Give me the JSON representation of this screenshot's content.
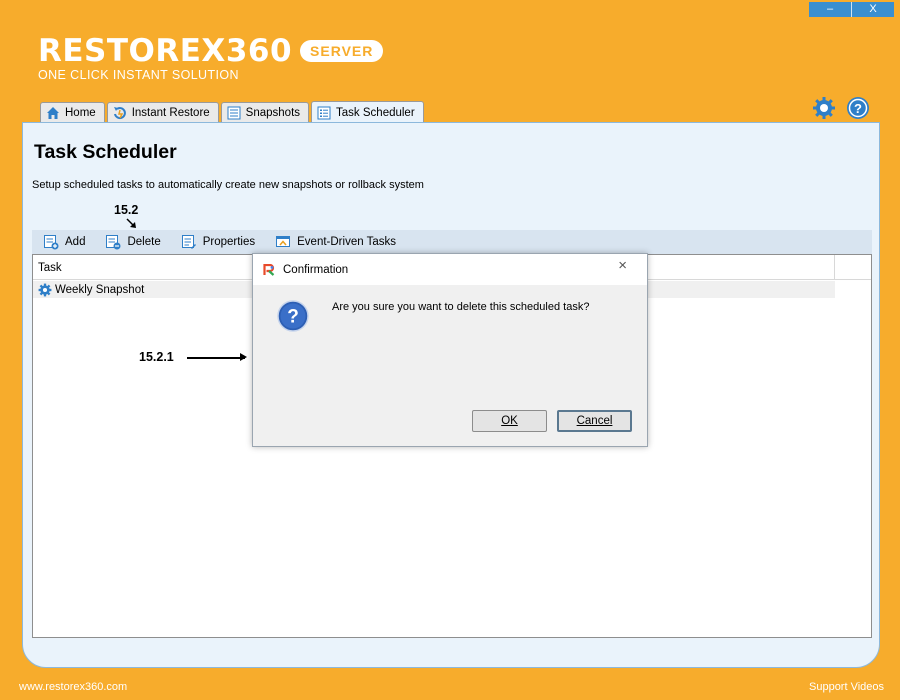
{
  "window": {
    "minimize_label": "–",
    "close_label": "X"
  },
  "brand": {
    "name": "RESTOREX360",
    "badge": "SERVER",
    "tagline": "ONE CLICK INSTANT SOLUTION"
  },
  "tabs": [
    {
      "label": "Home",
      "icon": "home-icon"
    },
    {
      "label": "Instant Restore",
      "icon": "instant-restore-icon"
    },
    {
      "label": "Snapshots",
      "icon": "snapshots-icon"
    },
    {
      "label": "Task Scheduler",
      "icon": "task-scheduler-icon",
      "active": true
    }
  ],
  "top_icons": [
    "settings-gear-icon",
    "help-question-icon"
  ],
  "page": {
    "title": "Task Scheduler",
    "description": "Setup scheduled tasks to automatically create new snapshots or rollback system"
  },
  "annotations": {
    "step_delete": "15.2",
    "step_confirm": "15.2.1"
  },
  "toolbar": {
    "add": "Add",
    "delete": "Delete",
    "properties": "Properties",
    "event_driven": "Event-Driven Tasks"
  },
  "table": {
    "columns": [
      "Task"
    ],
    "rows": [
      {
        "name": "Weekly Snapshot",
        "icon": "scheduled-task-gear-icon"
      }
    ]
  },
  "dialog": {
    "title": "Confirmation",
    "message": "Are you sure you want to delete this scheduled task?",
    "ok_label": "OK",
    "cancel_label": "Cancel",
    "close_label": "×"
  },
  "footer": {
    "website": "www.restorex360.com",
    "support": "Support Videos"
  },
  "colors": {
    "background": "#f7ac2c",
    "panel": "#eaf3fb",
    "accent": "#3a8fd0"
  }
}
